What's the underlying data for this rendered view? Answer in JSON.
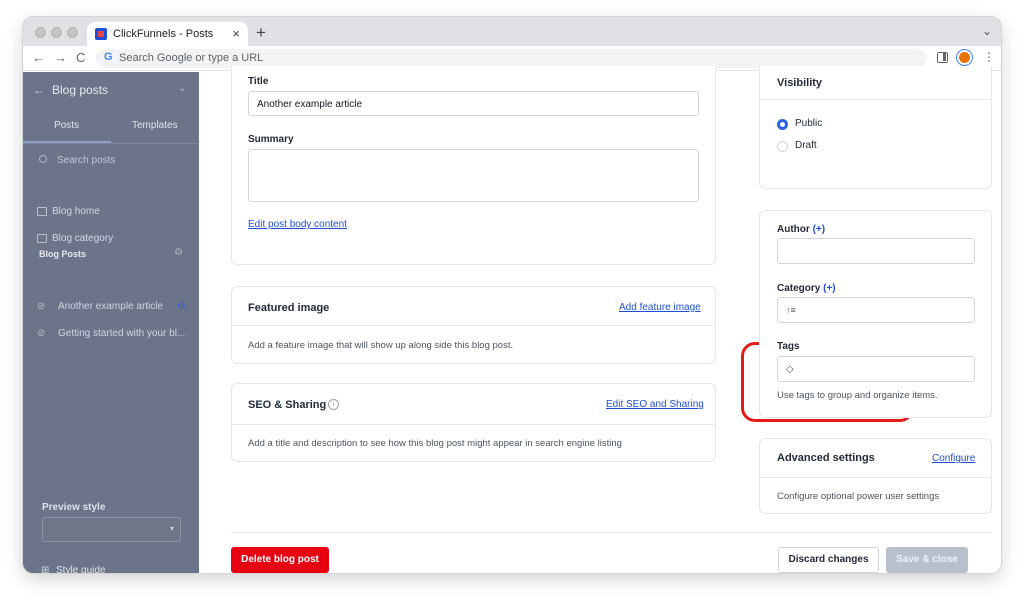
{
  "browser": {
    "tab_title": "ClickFunnels - Posts",
    "tab_close": "×",
    "new_tab": "+",
    "tab_menu": "⌄",
    "omnibox_placeholder": "Search Google or type a URL",
    "back": "←",
    "forward": "→",
    "reload": "C",
    "google_letter": "G",
    "menu": "⋮"
  },
  "sidebar": {
    "back": "←",
    "title": "Blog posts",
    "chevron": "⌄",
    "tabs": [
      "Posts",
      "Templates"
    ],
    "search_placeholder": "Search posts",
    "items": [
      "Blog home",
      "Blog category"
    ],
    "section_title": "Blog Posts",
    "posts": [
      "Another example article",
      "Getting started with your bl..."
    ],
    "preview_label": "Preview style",
    "preview_chevron": "▾",
    "style_guide": "Style guide"
  },
  "editor": {
    "title_label": "Title",
    "title_value": "Another example article",
    "summary_label": "Summary",
    "summary_value": "",
    "edit_body_link": "Edit post body content"
  },
  "featured_image": {
    "title": "Featured image",
    "action": "Add feature image",
    "description": "Add a feature image that will show up along side this blog post."
  },
  "seo": {
    "title": "SEO & Sharing",
    "info": "i",
    "action": "Edit SEO and Sharing",
    "description": "Add a title and description to see how this blog post might appear in search engine listing"
  },
  "visibility": {
    "title": "Visibility",
    "options": [
      "Public",
      "Draft"
    ],
    "selected": "Public"
  },
  "meta": {
    "author_label": "Author",
    "plus": "(+)",
    "author_value": "",
    "category_label": "Category",
    "category_icon": "↑≡",
    "tags_label": "Tags",
    "tags_icon": "◇",
    "tags_help": "Use tags to group and organize items."
  },
  "advanced": {
    "title": "Advanced settings",
    "action": "Configure",
    "description": "Configure optional power user settings"
  },
  "footer": {
    "delete": "Delete blog post",
    "discard": "Discard changes",
    "save": "Save & close"
  },
  "colors": {
    "accent": "#1d4ed8",
    "danger": "#e60012",
    "sidebar": "#6b7488",
    "highlight": "#e41b1b"
  }
}
